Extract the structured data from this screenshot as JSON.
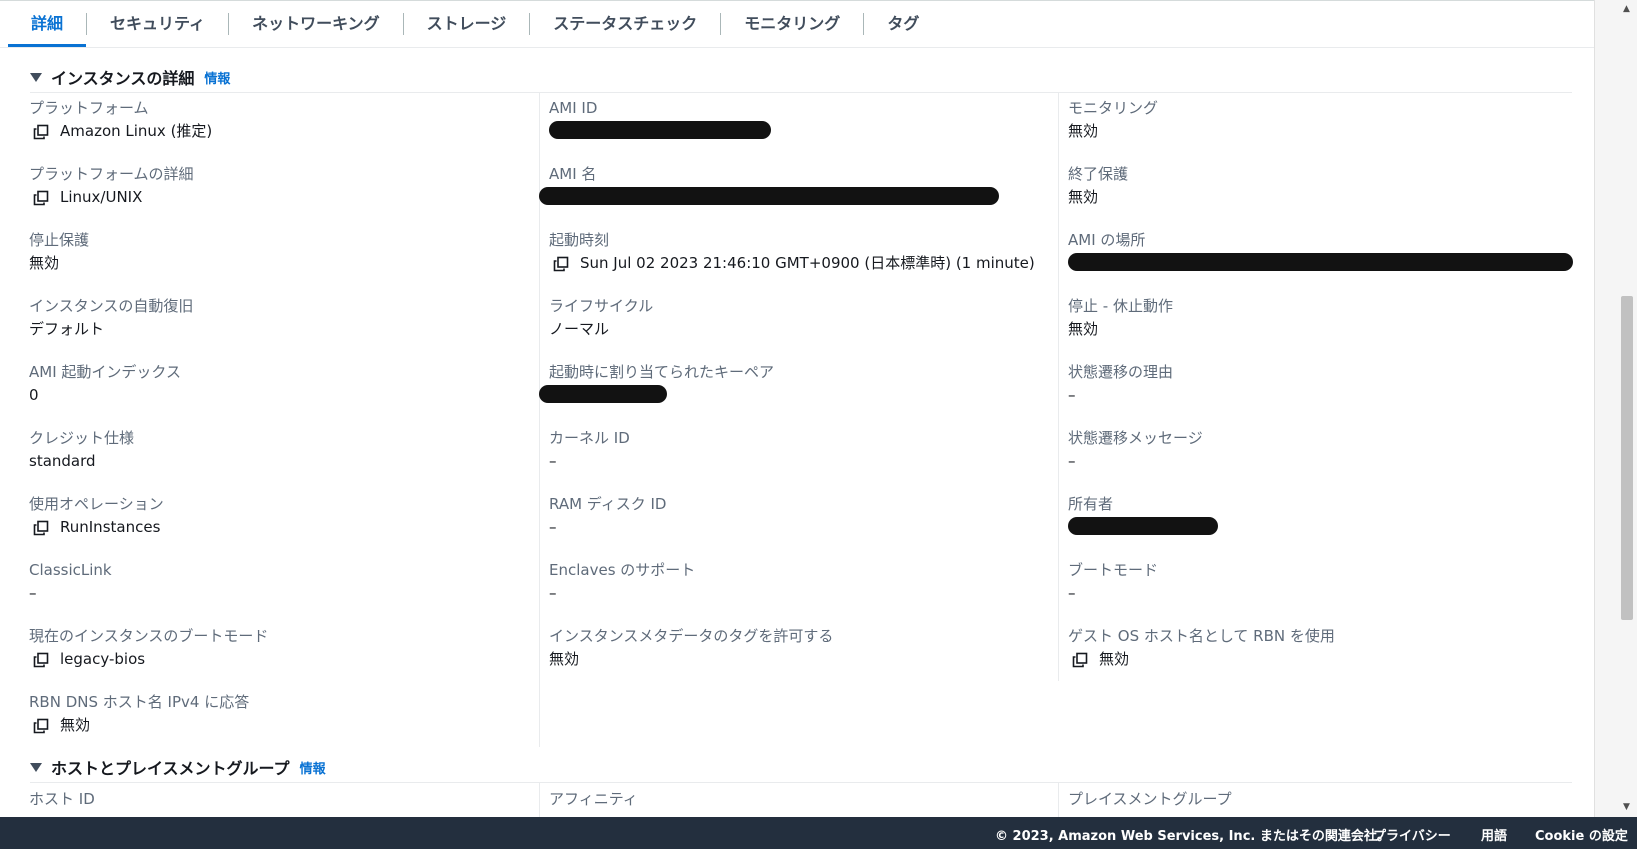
{
  "tabs": [
    {
      "label": "詳細",
      "active": true
    },
    {
      "label": "セキュリティ"
    },
    {
      "label": "ネットワーキング"
    },
    {
      "label": "ストレージ"
    },
    {
      "label": "ステータスチェック"
    },
    {
      "label": "モニタリング"
    },
    {
      "label": "タグ"
    }
  ],
  "instance_details": {
    "title": "インスタンスの詳細",
    "info": "情報",
    "col1": [
      {
        "label": "プラットフォーム",
        "value": "Amazon Linux (推定)",
        "copy": true
      },
      {
        "label": "プラットフォームの詳細",
        "value": "Linux/UNIX",
        "copy": true
      },
      {
        "label": "停止保護",
        "value": "無効"
      },
      {
        "label": "インスタンスの自動復旧",
        "value": "デフォルト"
      },
      {
        "label": "AMI 起動インデックス",
        "value": "0"
      },
      {
        "label": "クレジット仕様",
        "value": "standard"
      },
      {
        "label": "使用オペレーション",
        "value": "RunInstances",
        "copy": true
      },
      {
        "label": "ClassicLink",
        "value": "–"
      },
      {
        "label": "現在のインスタンスのブートモード",
        "value": "legacy-bios",
        "copy": true
      },
      {
        "label": "RBN DNS ホスト名 IPv4 に応答",
        "value": "無効",
        "copy": true
      }
    ],
    "col2": [
      {
        "label": "AMI ID",
        "redacted": true
      },
      {
        "label": "AMI 名",
        "redacted": true
      },
      {
        "label": "起動時刻",
        "value": "Sun Jul 02 2023 21:46:10 GMT+0900 (日本標準時) (1 minute)",
        "copy": true
      },
      {
        "label": "ライフサイクル",
        "value": "ノーマル"
      },
      {
        "label": "起動時に割り当てられたキーペア",
        "redacted": true
      },
      {
        "label": "カーネル ID",
        "value": "–"
      },
      {
        "label": "RAM ディスク ID",
        "value": "–"
      },
      {
        "label": "Enclaves のサポート",
        "value": "–"
      },
      {
        "label": "インスタンスメタデータのタグを許可する",
        "value": "無効"
      }
    ],
    "col3": [
      {
        "label": "モニタリング",
        "value": "無効"
      },
      {
        "label": "終了保護",
        "value": "無効"
      },
      {
        "label": "AMI の場所",
        "redacted": true
      },
      {
        "label": "停止 - 休止動作",
        "value": "無効"
      },
      {
        "label": "状態遷移の理由",
        "value": "–"
      },
      {
        "label": "状態遷移メッセージ",
        "value": "–"
      },
      {
        "label": "所有者",
        "redacted": true
      },
      {
        "label": "ブートモード",
        "value": "–"
      },
      {
        "label": "ゲスト OS ホスト名として RBN を使用",
        "value": "無効",
        "copy": true
      }
    ]
  },
  "host_placement": {
    "title": "ホストとプレイスメントグループ",
    "info": "情報",
    "labels": [
      "ホスト ID",
      "アフィニティ",
      "プレイスメントグループ"
    ]
  },
  "footer": {
    "copyright": "© 2023, Amazon Web Services, Inc. またはその関連会社。",
    "privacy": "プライバシー",
    "terms": "用語",
    "cookie": "Cookie の設定"
  }
}
